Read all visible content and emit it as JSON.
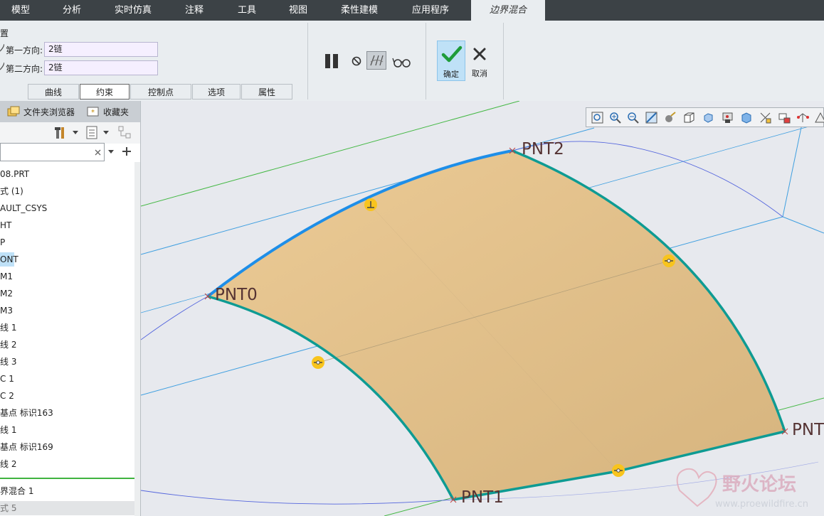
{
  "menu": {
    "tabs": [
      "模型",
      "分析",
      "实时仿真",
      "注释",
      "工具",
      "视图",
      "柔性建模",
      "应用程序",
      "边界混合"
    ]
  },
  "ribbon": {
    "group_label_partial": "置",
    "first_direction_label": "第一方向:",
    "first_direction_value": "2链",
    "second_direction_label": "第二方向:",
    "second_direction_value": "2链",
    "subtabs": [
      "曲线",
      "约束",
      "控制点",
      "选项",
      "属性"
    ],
    "ok_label": "确定",
    "cancel_label": "取消"
  },
  "left_panel": {
    "folder_browser": "文件夹浏览器",
    "favorites": "收藏夹",
    "tree_items": [
      "08.PRT",
      "式 (1)",
      "AULT_CSYS",
      "HT",
      "P",
      "ONT",
      "M1",
      "M2",
      "M3",
      "线 1",
      "线 2",
      "线 3",
      "C 1",
      "C 2",
      "基点 标识163",
      "线 1",
      "基点 标识169",
      "线 2",
      "界混合 1",
      "式 5"
    ]
  },
  "viewport": {
    "labels": [
      "PNT2",
      "PNT0",
      "PNT1",
      "PNT"
    ]
  },
  "watermark": {
    "title": "野火论坛",
    "url": "www.proewildfire.cn"
  },
  "colors": {
    "menubar": "#3c4246",
    "surface_fill": "#e6c58e",
    "boundary_teal": "#0e9b93",
    "boundary_blue": "#1e8ee8",
    "marker_yellow": "#f8c41d",
    "selection_blue": "#bfe1f7",
    "ok_button_bg": "#bfe1f7"
  }
}
